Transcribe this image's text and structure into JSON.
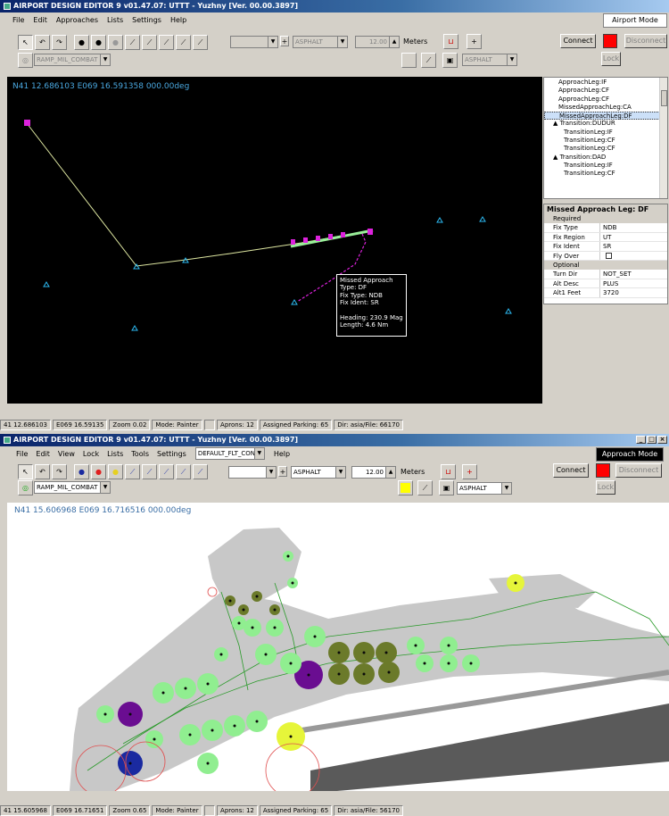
{
  "top": {
    "title": "AIRPORT DESIGN EDITOR 9  v01.47.07: UTTT - Yuzhny [Ver. 00.00.3897]",
    "menu": [
      "File",
      "Edit",
      "Approaches",
      "Lists",
      "Settings",
      "Help"
    ],
    "mode": "Airport Mode",
    "connect": "Connect",
    "disconnect": "Disconnect",
    "lock": "Lock",
    "ramp_combo": "RAMP_MIL_COMBAT",
    "surface_combo": "ASPHALT",
    "width_value": "12.00",
    "width_unit": "Meters",
    "surface_combo2": "ASPHALT",
    "coords": "N41 12.686103   E069 16.591358 000.00deg",
    "tree": [
      {
        "label": "ApproachLeg:IF",
        "indent": 2,
        "selected": false
      },
      {
        "label": "ApproachLeg:CF",
        "indent": 2,
        "selected": false
      },
      {
        "label": "ApproachLeg:CF",
        "indent": 2,
        "selected": false
      },
      {
        "label": "MissedApproachLeg:CA",
        "indent": 2,
        "selected": false
      },
      {
        "label": "MissedApproachLeg:DF",
        "indent": 2,
        "selected": true
      },
      {
        "label": "Transition:DUDUR",
        "indent": 1,
        "selected": false
      },
      {
        "label": "TransitionLeg:IF",
        "indent": 3,
        "selected": false
      },
      {
        "label": "TransitionLeg:CF",
        "indent": 3,
        "selected": false
      },
      {
        "label": "TransitionLeg:CF",
        "indent": 3,
        "selected": false
      },
      {
        "label": "Transition:DAD",
        "indent": 1,
        "selected": false
      },
      {
        "label": "TransitionLeg:IF",
        "indent": 3,
        "selected": false
      },
      {
        "label": "TransitionLeg:CF",
        "indent": 3,
        "selected": false
      }
    ],
    "props_title": "Missed Approach Leg: DF",
    "required_label": "Required",
    "required": [
      {
        "k": "Fix Type",
        "v": "NDB"
      },
      {
        "k": "Fix Region",
        "v": "UT"
      },
      {
        "k": "Fix Ident",
        "v": "SR"
      },
      {
        "k": "Fly Over",
        "v": ""
      }
    ],
    "optional_label": "Optional",
    "optional": [
      {
        "k": "Turn Dir",
        "v": "NOT_SET"
      },
      {
        "k": "Alt Desc",
        "v": "PLUS"
      },
      {
        "k": "Alt1 Feet",
        "v": "3720"
      }
    ],
    "tooltip": [
      "Missed Approach",
      "Type: DF",
      "Fix Type: NDB",
      "Fix Ident: SR",
      "",
      "Heading: 230.9 Mag",
      "Length: 4.6 Nm"
    ],
    "status": [
      "41 12.686103",
      "E069 16.59135",
      "Zoom 0.02",
      "Mode: Painter",
      "",
      "Aprons: 12",
      "Assigned Parking: 65",
      "Dir: asia/File: 66170"
    ]
  },
  "bottom": {
    "title": "AIRPORT DESIGN EDITOR 9  v01.47.07: UTTT - Yuzhny [Ver. 00.00.3897]",
    "menu": [
      "File",
      "Edit",
      "View",
      "Lock",
      "Lists",
      "Tools",
      "Settings"
    ],
    "menu_combo": "DEFAULT_FLT_CONSL",
    "menu_help": "Help",
    "mode": "Approach Mode",
    "connect": "Connect",
    "disconnect": "Disconnect",
    "lock": "Lock",
    "ramp_combo": "RAMP_MIL_COMBAT",
    "surface_combo": "ASPHALT",
    "width_value": "12.00",
    "width_unit": "Meters",
    "surface_combo2": "ASPHALT",
    "coords": "N41 15.606968   E069 16.716516 000.00deg",
    "status": [
      "41 15.605968",
      "E069 16.71651",
      "Zoom 0.65",
      "Mode: Painter",
      "",
      "Aprons: 12",
      "Assigned Parking: 65",
      "Dir: asia/File: 56170"
    ]
  },
  "colors": {
    "map_bg_dark": "#000000",
    "taxi_line": "#f0e68c",
    "approach_path": "#dd22dd",
    "parking_green": "#90ee90",
    "parking_olive": "#6b7a2a",
    "parking_purple": "#6a0d91",
    "parking_blue": "#1a2aa0",
    "parking_yellow": "#e6f53a"
  }
}
